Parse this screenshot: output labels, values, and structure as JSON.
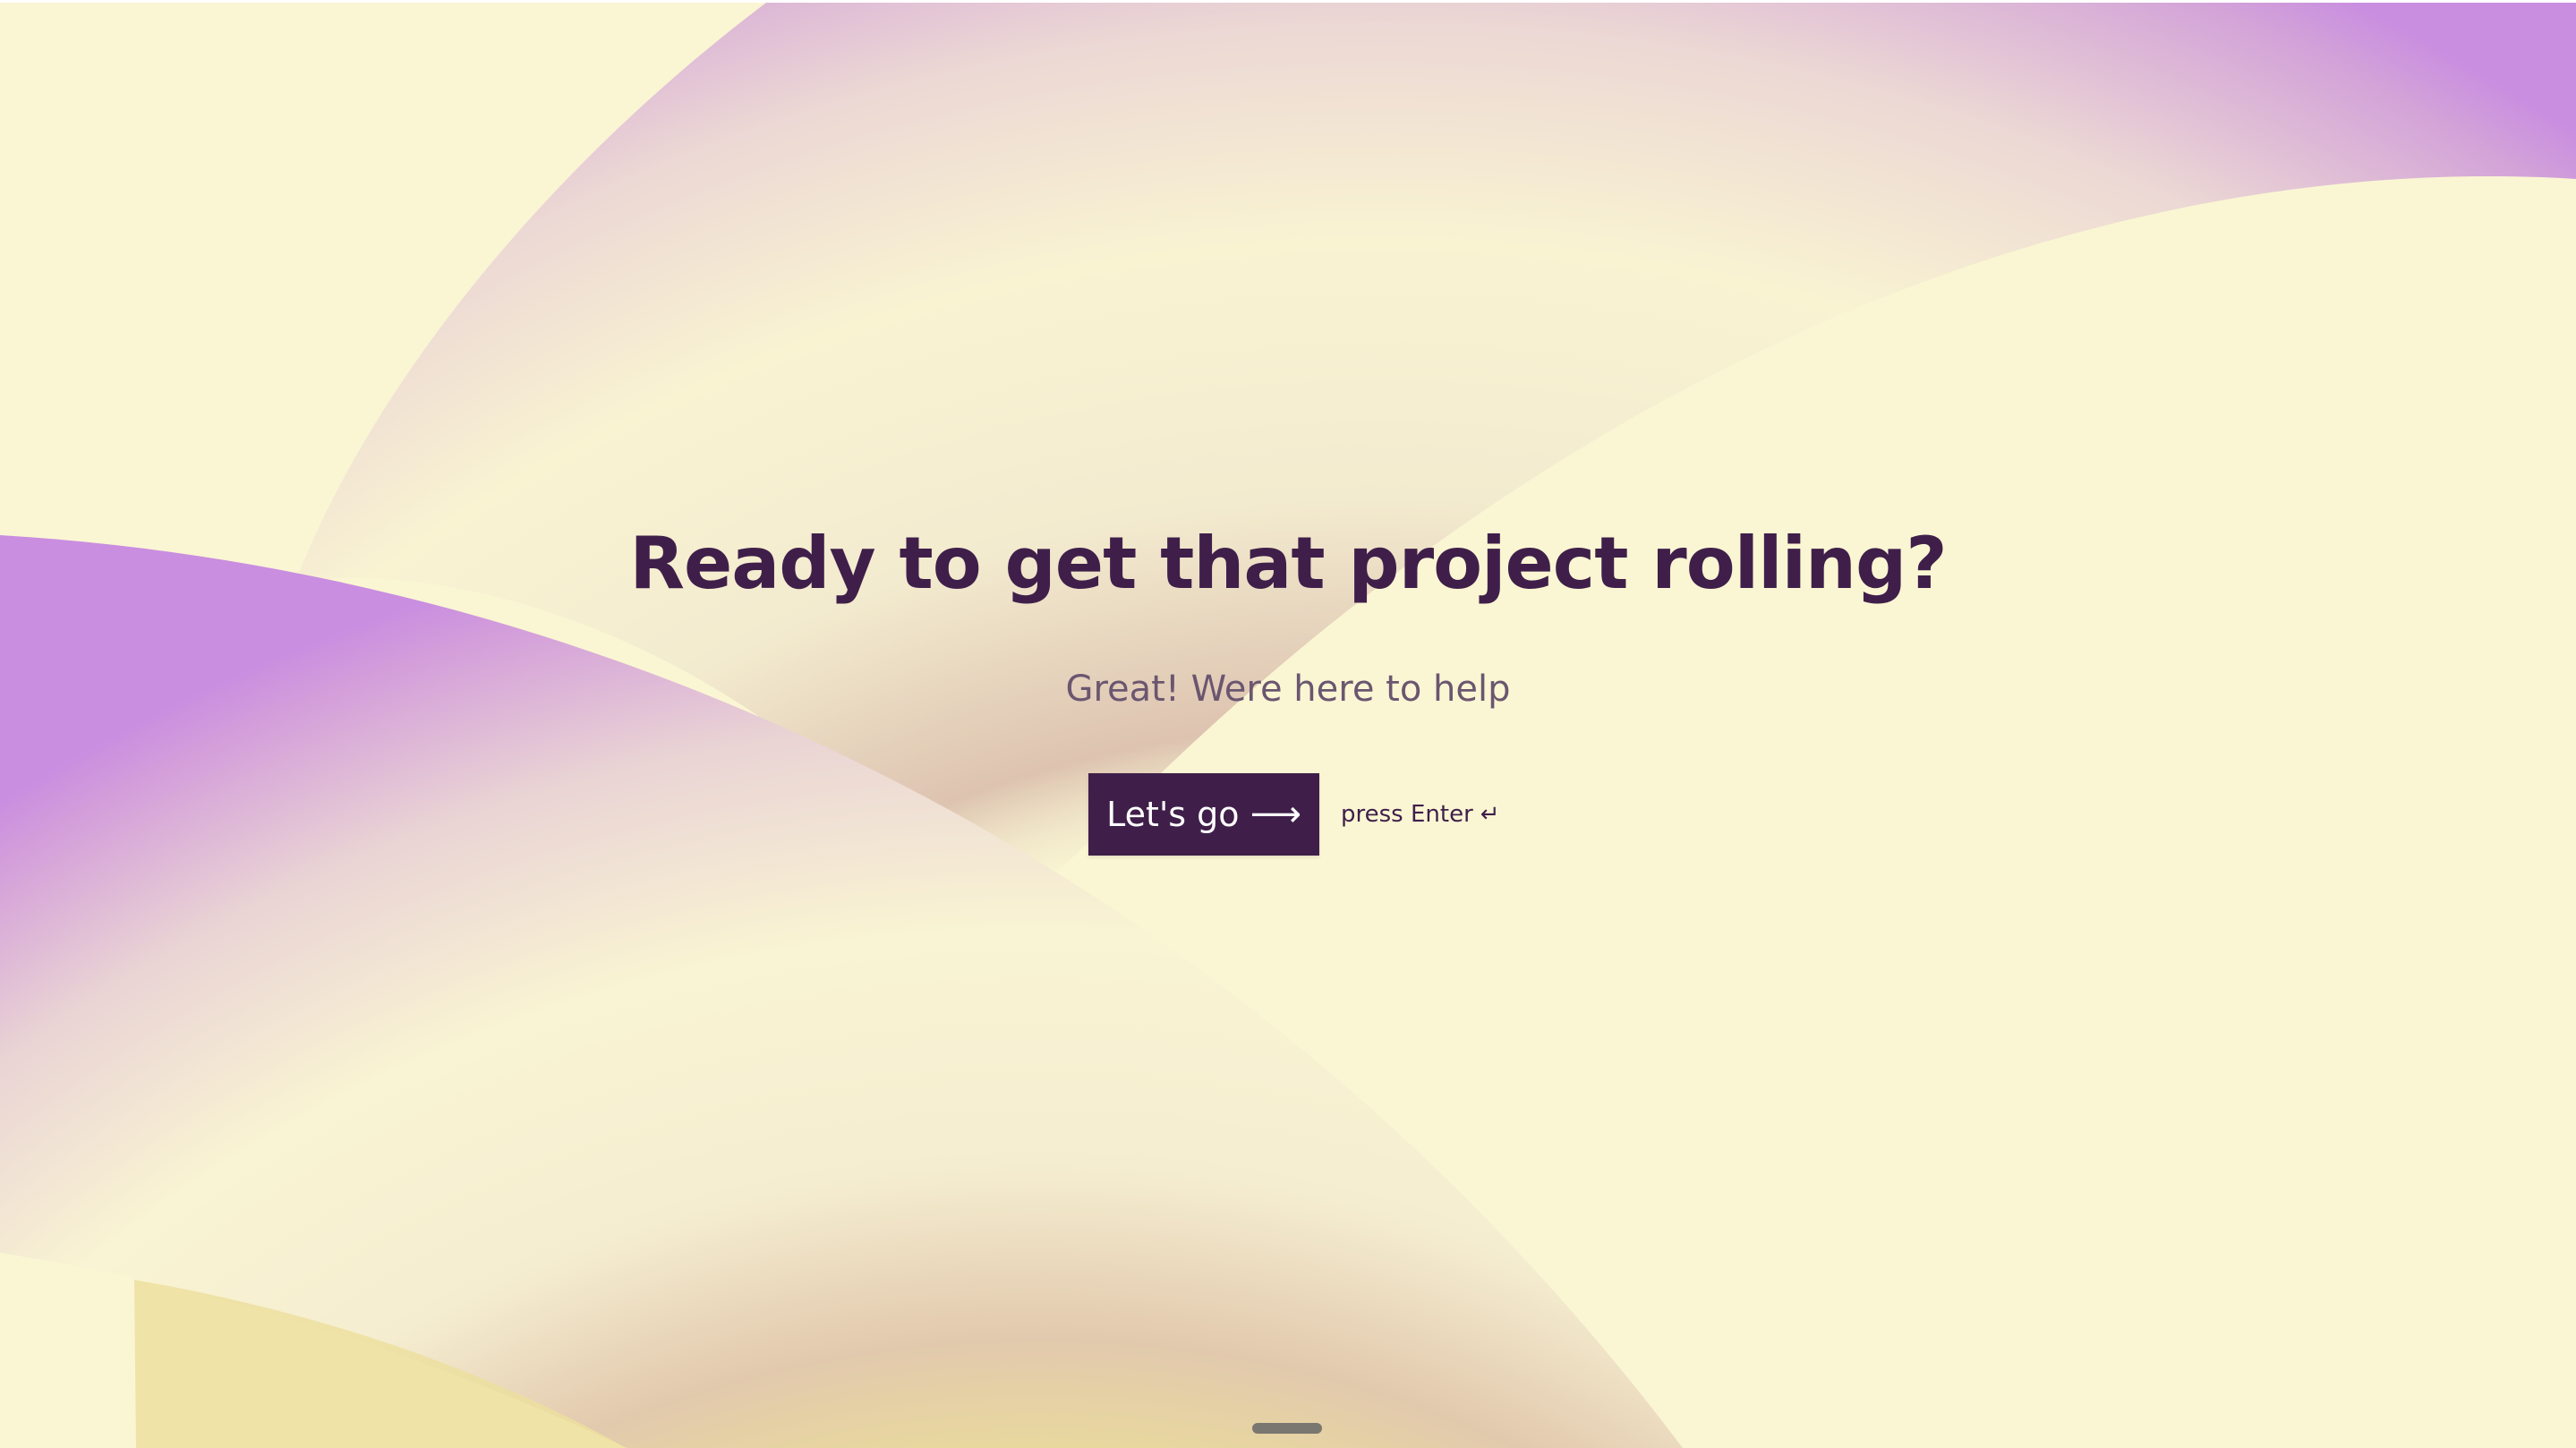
{
  "page": {
    "headline": "Ready to get that project rolling?",
    "subheadline": "Great! Were here to help"
  },
  "cta": {
    "label": "Let's go",
    "arrow_glyph": "⟶",
    "arrow_icon": "arrow-right-icon",
    "hint_text": "press Enter",
    "hint_glyph": "↵",
    "hint_icon": "enter-key-icon"
  },
  "colors": {
    "background": "#faf6d3",
    "primary": "#3f1f4a",
    "subtext": "#6b5670",
    "arc_purple": "#c98ee0",
    "arc_cream": "#f7f0d0",
    "arc_tan": "#e2c7a8"
  }
}
